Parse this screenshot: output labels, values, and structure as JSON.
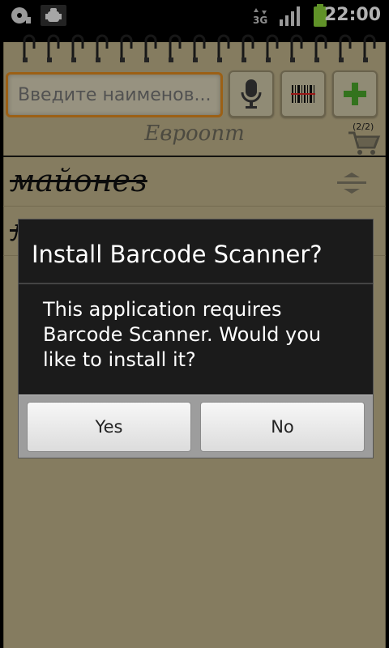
{
  "status_bar": {
    "time": "22:00",
    "network": "3G",
    "icons": [
      "disc-icon",
      "android-debug-icon",
      "data-transfer-icon",
      "signal-icon",
      "battery-icon"
    ]
  },
  "toolbar": {
    "search_placeholder": "Введите наименов...",
    "icons": [
      "microphone-icon",
      "barcode-icon",
      "plus-icon"
    ]
  },
  "list": {
    "store_name": "Евроопт",
    "cart_count": "(2/2)",
    "items": [
      {
        "name": "майонез",
        "crossed": true
      },
      {
        "name": "масло",
        "crossed": true
      }
    ]
  },
  "dialog": {
    "title": "Install Barcode Scanner?",
    "message": "This application requires Barcode Scanner. Would you like to install it?",
    "yes_label": "Yes",
    "no_label": "No"
  },
  "colors": {
    "paper": "#bfb28a",
    "input_focus": "#e08a1f",
    "dialog_bg": "#1b1b1b",
    "plus_green": "#4aa52a"
  }
}
